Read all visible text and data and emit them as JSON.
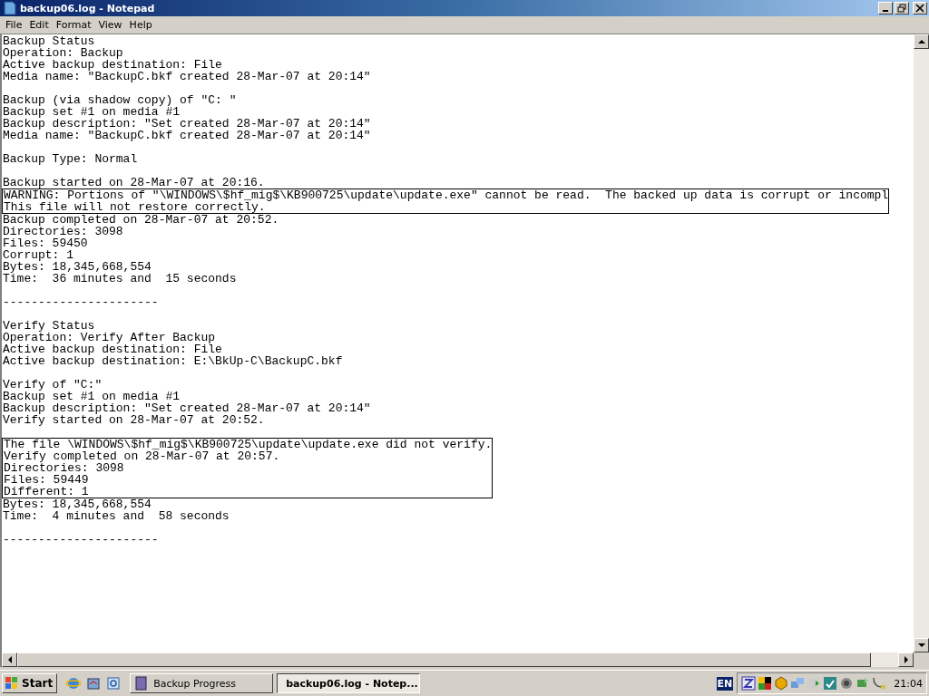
{
  "window": {
    "title": "backup06.log - Notepad"
  },
  "menu": [
    "File",
    "Edit",
    "Format",
    "View",
    "Help"
  ],
  "document": [
    {
      "kind": "paragraph",
      "lines": [
        "Backup Status",
        "Operation: Backup",
        "Active backup destination: File",
        "Media name: \"BackupC.bkf created 28-Mar-07 at 20:14\""
      ]
    },
    {
      "kind": "paragraph",
      "lines": [
        "Backup (via shadow copy) of \"C: \"",
        "Backup set #1 on media #1",
        "Backup description: \"Set created 28-Mar-07 at 20:14\"",
        "Media name: \"BackupC.bkf created 28-Mar-07 at 20:14\""
      ]
    },
    {
      "kind": "paragraph",
      "lines": [
        "Backup Type: Normal"
      ]
    },
    {
      "kind": "lines",
      "lines": [
        "Backup started on 28-Mar-07 at 20:16."
      ]
    },
    {
      "kind": "boxed",
      "lines": [
        "WARNING: Portions of \"\\WINDOWS\\$hf_mig$\\KB900725\\update\\update.exe\" cannot be read.  The backed up data is corrupt or incompl",
        "This file will not restore correctly."
      ]
    },
    {
      "kind": "paragraph",
      "lines": [
        "Backup completed on 28-Mar-07 at 20:52.",
        "Directories: 3098",
        "Files: 59450",
        "Corrupt: 1",
        "Bytes: 18,345,668,554",
        "Time:  36 minutes and  15 seconds"
      ]
    },
    {
      "kind": "paragraph",
      "lines": [
        "----------------------"
      ]
    },
    {
      "kind": "paragraph",
      "lines": [
        "Verify Status",
        "Operation: Verify After Backup",
        "Active backup destination: File",
        "Active backup destination: E:\\BkUp-C\\BackupC.bkf"
      ]
    },
    {
      "kind": "paragraph",
      "lines": [
        "Verify of \"C:\"",
        "Backup set #1 on media #1",
        "Backup description: \"Set created 28-Mar-07 at 20:14\"",
        "Verify started on 28-Mar-07 at 20:52."
      ]
    },
    {
      "kind": "boxed",
      "lines": [
        "The file \\WINDOWS\\$hf_mig$\\KB900725\\update\\update.exe did not verify.",
        "Verify completed on 28-Mar-07 at 20:57.",
        "Directories: 3098",
        "Files: 59449",
        "Different: 1"
      ]
    },
    {
      "kind": "paragraph",
      "lines": [
        "Bytes: 18,345,668,554",
        "Time:  4 minutes and  58 seconds"
      ]
    },
    {
      "kind": "lines",
      "lines": [
        "----------------------"
      ]
    }
  ],
  "taskbar": {
    "start": "Start",
    "tasks": [
      {
        "label": "Backup Progress",
        "selected": false
      },
      {
        "label": "backup06.log - Notep...",
        "selected": true
      }
    ],
    "language": "EN",
    "clock": "21:04"
  }
}
